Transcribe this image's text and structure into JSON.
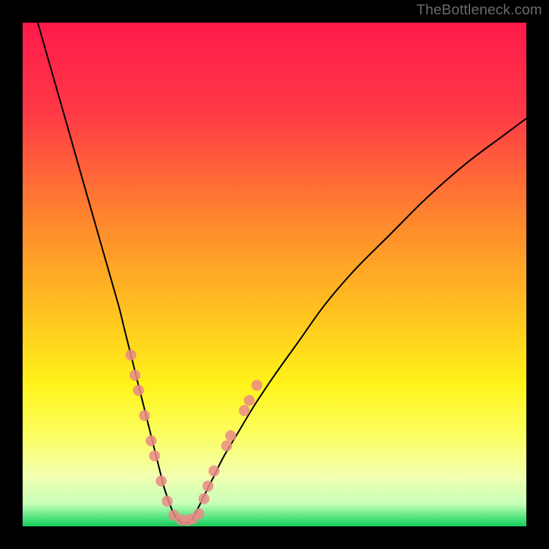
{
  "watermark": "TheBottleneck.com",
  "chart_data": {
    "type": "line",
    "title": "",
    "xlabel": "",
    "ylabel": "",
    "xlim": [
      0,
      100
    ],
    "ylim": [
      0,
      100
    ],
    "grid": false,
    "background_gradient": {
      "stops": [
        {
          "offset": 0.0,
          "color": "#ff1a4b"
        },
        {
          "offset": 0.18,
          "color": "#ff3a46"
        },
        {
          "offset": 0.4,
          "color": "#ff8a2d"
        },
        {
          "offset": 0.58,
          "color": "#ffc41f"
        },
        {
          "offset": 0.72,
          "color": "#fff31a"
        },
        {
          "offset": 0.82,
          "color": "#fbff61"
        },
        {
          "offset": 0.9,
          "color": "#f2ffb0"
        },
        {
          "offset": 0.955,
          "color": "#c8ffb8"
        },
        {
          "offset": 0.985,
          "color": "#49e27a"
        },
        {
          "offset": 1.0,
          "color": "#16c95a"
        }
      ]
    },
    "series": [
      {
        "name": "bottleneck-curve",
        "color": "#000000",
        "x": [
          3,
          5,
          7,
          9,
          11,
          13,
          15,
          17,
          19,
          20,
          21,
          22,
          23,
          24,
          25,
          26,
          27,
          28,
          29,
          30,
          31,
          32,
          33,
          34,
          36,
          38,
          40,
          43,
          46,
          50,
          55,
          60,
          66,
          73,
          80,
          88,
          96,
          100
        ],
        "y": [
          100,
          93,
          86,
          79,
          72,
          65,
          58,
          51,
          44,
          40,
          36,
          32,
          28,
          24,
          20,
          16,
          12,
          8,
          5,
          2.5,
          1.2,
          0.6,
          0.8,
          2,
          6,
          10,
          14,
          19,
          24,
          30,
          37,
          44,
          51,
          58,
          65,
          72,
          78,
          81
        ]
      }
    ],
    "markers": {
      "name": "sample-points",
      "color": "#e98b86",
      "radius": 8,
      "points": [
        {
          "x": 21.5,
          "y": 34
        },
        {
          "x": 22.3,
          "y": 30
        },
        {
          "x": 23.0,
          "y": 27
        },
        {
          "x": 24.2,
          "y": 22
        },
        {
          "x": 25.5,
          "y": 17
        },
        {
          "x": 26.2,
          "y": 14
        },
        {
          "x": 27.5,
          "y": 9
        },
        {
          "x": 28.7,
          "y": 5
        },
        {
          "x": 30.0,
          "y": 2.2
        },
        {
          "x": 31.5,
          "y": 1.3
        },
        {
          "x": 32.7,
          "y": 1.2
        },
        {
          "x": 33.8,
          "y": 1.5
        },
        {
          "x": 35.0,
          "y": 2.5
        },
        {
          "x": 36.0,
          "y": 5.5
        },
        {
          "x": 36.8,
          "y": 8
        },
        {
          "x": 38.0,
          "y": 11
        },
        {
          "x": 40.5,
          "y": 16
        },
        {
          "x": 41.3,
          "y": 18
        },
        {
          "x": 44.0,
          "y": 23
        },
        {
          "x": 45.0,
          "y": 25
        },
        {
          "x": 46.5,
          "y": 28
        }
      ]
    }
  }
}
